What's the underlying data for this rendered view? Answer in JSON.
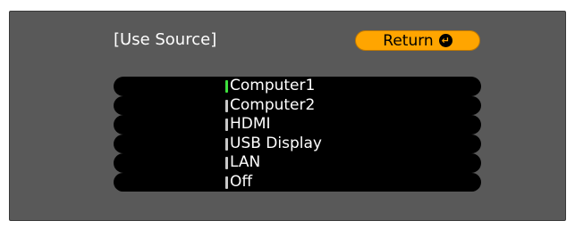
{
  "dialog": {
    "title": "[Use Source]",
    "return_label": "Return",
    "return_icon": "enter-icon",
    "colors": {
      "panel": "#595959",
      "return_button": "#ffa500",
      "selected_marker": "#3de03d",
      "marker": "#c8c8c8"
    }
  },
  "sources": [
    {
      "label": "Computer1",
      "selected": true
    },
    {
      "label": "Computer2",
      "selected": false
    },
    {
      "label": "HDMI",
      "selected": false
    },
    {
      "label": "USB Display",
      "selected": false
    },
    {
      "label": "LAN",
      "selected": false
    },
    {
      "label": "Off",
      "selected": false
    }
  ]
}
